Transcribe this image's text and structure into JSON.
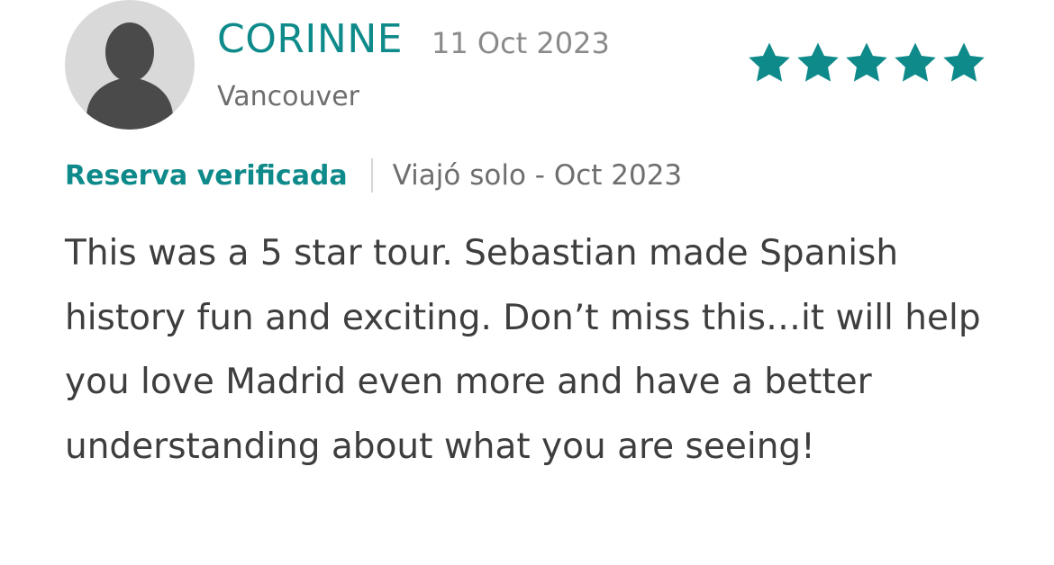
{
  "colors": {
    "accent": "#0f8a8a",
    "muted_text": "#8a8a8a",
    "body_text": "#3e3e3e",
    "avatar_bg": "#d9d9d9",
    "avatar_silhouette": "#4a4a4a"
  },
  "review": {
    "reviewer": {
      "name": "CORINNE",
      "location": "Vancouver",
      "avatar_icon": "default-user-silhouette"
    },
    "date": "11 Oct 2023",
    "rating": {
      "value": 5,
      "max": 5,
      "icon": "star-icon"
    },
    "verified_label": "Reserva verificada",
    "trip_info": "Viajó solo - Oct 2023",
    "body": "This was a 5 star tour. Sebastian made Spanish history fun and exciting. Don’t miss this…it will help you love Madrid even more and have a better understanding about what you are seeing!"
  }
}
